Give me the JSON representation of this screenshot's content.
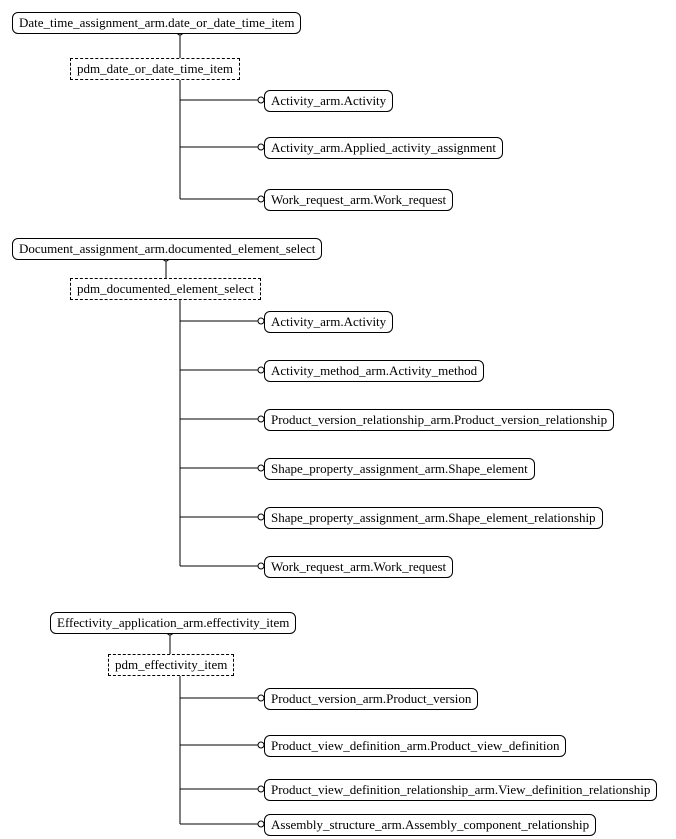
{
  "diagram": {
    "groups": [
      {
        "root": "Date_time_assignment_arm.date_or_date_time_item",
        "sub": "pdm_date_or_date_time_item",
        "children": [
          "Activity_arm.Activity",
          "Activity_arm.Applied_activity_assignment",
          "Work_request_arm.Work_request"
        ]
      },
      {
        "root": "Document_assignment_arm.documented_element_select",
        "sub": "pdm_documented_element_select",
        "children": [
          "Activity_arm.Activity",
          "Activity_method_arm.Activity_method",
          "Product_version_relationship_arm.Product_version_relationship",
          "Shape_property_assignment_arm.Shape_element",
          "Shape_property_assignment_arm.Shape_element_relationship",
          "Work_request_arm.Work_request"
        ]
      },
      {
        "root": "Effectivity_application_arm.effectivity_item",
        "sub": "pdm_effectivity_item",
        "children": [
          "Product_version_arm.Product_version",
          "Product_view_definition_arm.Product_view_definition",
          "Product_view_definition_relationship_arm.View_definition_relationship",
          "Assembly_structure_arm.Assembly_component_relationship"
        ]
      }
    ]
  }
}
